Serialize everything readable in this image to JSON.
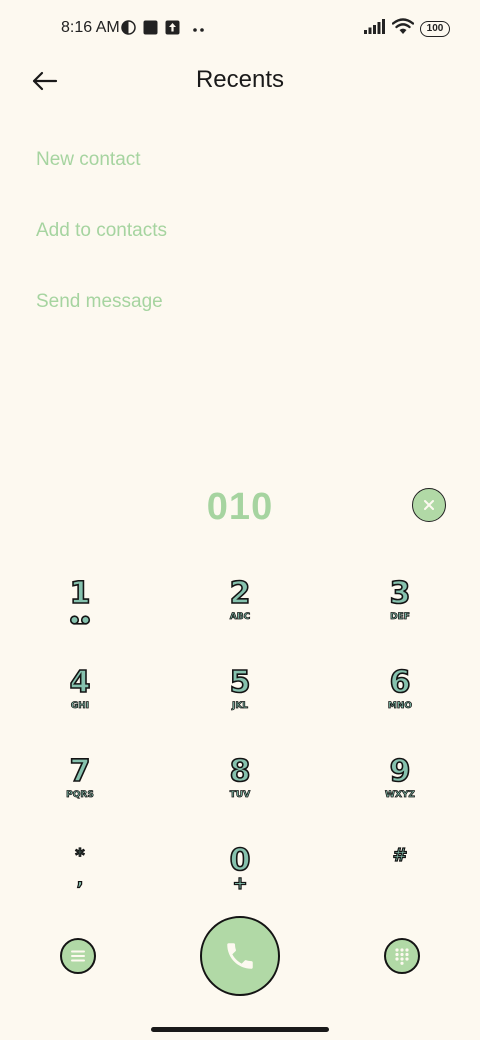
{
  "status_bar": {
    "time": "8:16 AM",
    "battery": "100",
    "icons": [
      "vpn-icon",
      "square-app-icon",
      "upload-icon",
      "more-notifications-icon",
      "signal-icon",
      "wifi-icon",
      "battery-icon"
    ]
  },
  "header": {
    "title": "Recents",
    "back_icon": "back-arrow-icon"
  },
  "options": {
    "new_contact": "New contact",
    "add_to_contacts": "Add to contacts",
    "send_message": "Send message"
  },
  "dialer": {
    "number": "010",
    "clear_icon": "close-icon"
  },
  "keypad": {
    "k1": {
      "digit": "1",
      "sub_icon": "voicemail-icon"
    },
    "k2": {
      "digit": "2",
      "letters": "ABC"
    },
    "k3": {
      "digit": "3",
      "letters": "DEF"
    },
    "k4": {
      "digit": "4",
      "letters": "GHI"
    },
    "k5": {
      "digit": "5",
      "letters": "JKL"
    },
    "k6": {
      "digit": "6",
      "letters": "MNO"
    },
    "k7": {
      "digit": "7",
      "letters": "PQRS"
    },
    "k8": {
      "digit": "8",
      "letters": "TUV"
    },
    "k9": {
      "digit": "9",
      "letters": "WXYZ"
    },
    "kstar": {
      "digit": "*",
      "letters": ","
    },
    "k0": {
      "digit": "0",
      "letters": "+"
    },
    "khash": {
      "digit": "#"
    }
  },
  "bottom_bar": {
    "menu_icon": "menu-icon",
    "call_icon": "phone-icon",
    "keypad_icon": "dialpad-icon"
  },
  "colors": {
    "background": "#fdf9f0",
    "accent_green": "#b1d9a6",
    "option_text": "#a6d4a0",
    "key_fill": "#86c2ae"
  }
}
